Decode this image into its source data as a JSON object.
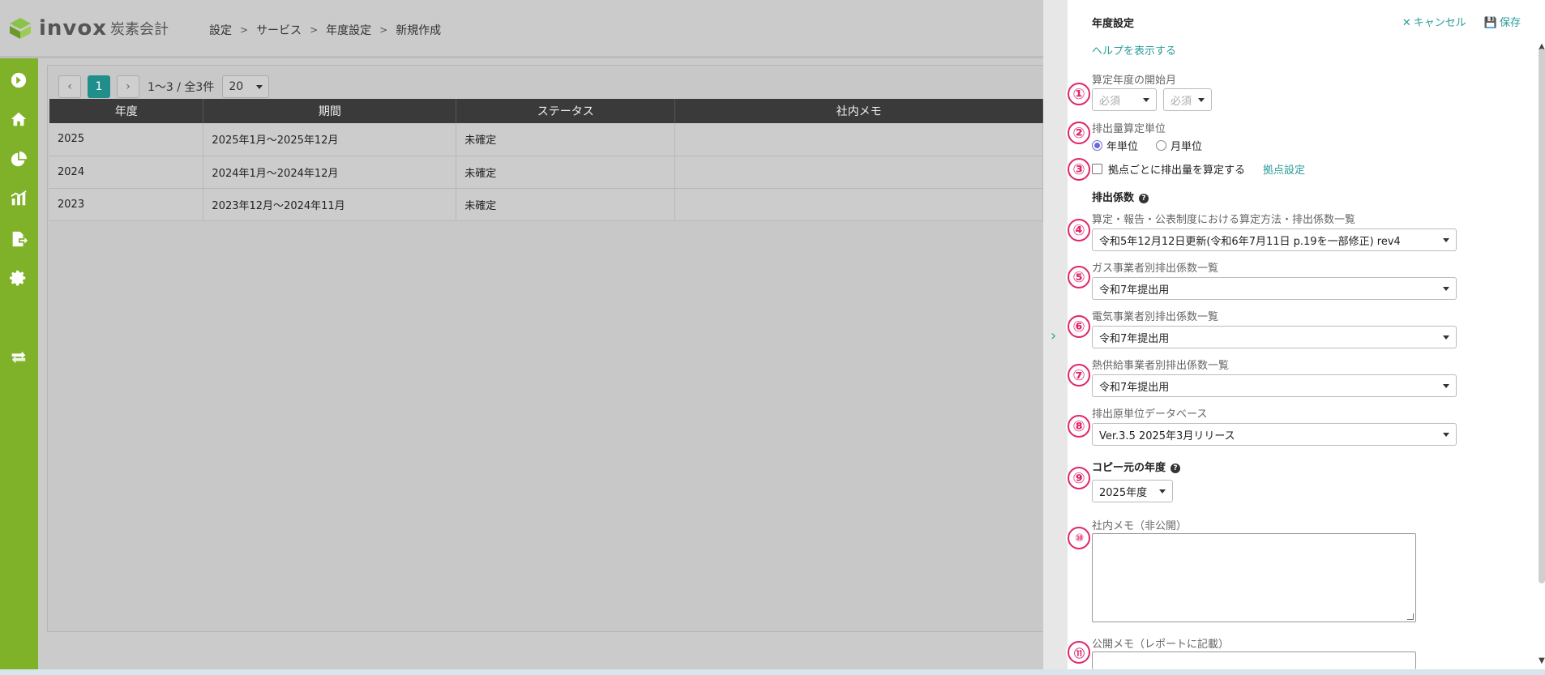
{
  "app": {
    "logo_text": "invox",
    "logo_sub": "炭素会計"
  },
  "breadcrumb": [
    "設定",
    "サービス",
    "年度設定",
    "新規作成"
  ],
  "pager": {
    "current": "1",
    "info": "1〜3 / 全3件",
    "page_size": "20"
  },
  "table": {
    "columns": [
      "年度",
      "期間",
      "ステータス",
      "社内メモ"
    ],
    "rows": [
      [
        "2025",
        "2025年1月〜2025年12月",
        "未確定",
        ""
      ],
      [
        "2024",
        "2024年1月〜2024年12月",
        "未確定",
        ""
      ],
      [
        "2023",
        "2023年12月〜2024年11月",
        "未確定",
        ""
      ]
    ]
  },
  "drawer": {
    "title": "年度設定",
    "cancel": "キャンセル",
    "save": "保存",
    "help": "ヘルプを表示する",
    "start_month_label": "算定年度の開始月",
    "start_placeholder_1": "必須",
    "start_placeholder_2": "必須",
    "unit_label": "排出量算定単位",
    "unit_year": "年単位",
    "unit_month": "月単位",
    "per_site_label": "拠点ごとに排出量を算定する",
    "site_settings": "拠点設定",
    "factors_heading": "排出係数",
    "method_label": "算定・報告・公表制度における算定方法・排出係数一覧",
    "method_value": "令和5年12月12日更新(令和6年7月11日 p.19を一部修正) rev4",
    "gas_label": "ガス事業者別排出係数一覧",
    "gas_value": "令和7年提出用",
    "elec_label": "電気事業者別排出係数一覧",
    "elec_value": "令和7年提出用",
    "heat_label": "熱供給事業者別排出係数一覧",
    "heat_value": "令和7年提出用",
    "db_label": "排出原単位データベース",
    "db_value": "Ver.3.5 2025年3月リリース",
    "copy_heading": "コピー元の年度",
    "copy_value": "2025年度",
    "internal_memo_label": "社内メモ（非公開）",
    "public_memo_label": "公開メモ（レポートに記載）"
  },
  "markers": [
    "①",
    "②",
    "③",
    "④",
    "⑤",
    "⑥",
    "⑦",
    "⑧",
    "⑨",
    "⑩",
    "⑪"
  ],
  "colors": {
    "sidebar": "#7fb229",
    "accent": "#2a9c99",
    "marker": "#e1256c"
  }
}
